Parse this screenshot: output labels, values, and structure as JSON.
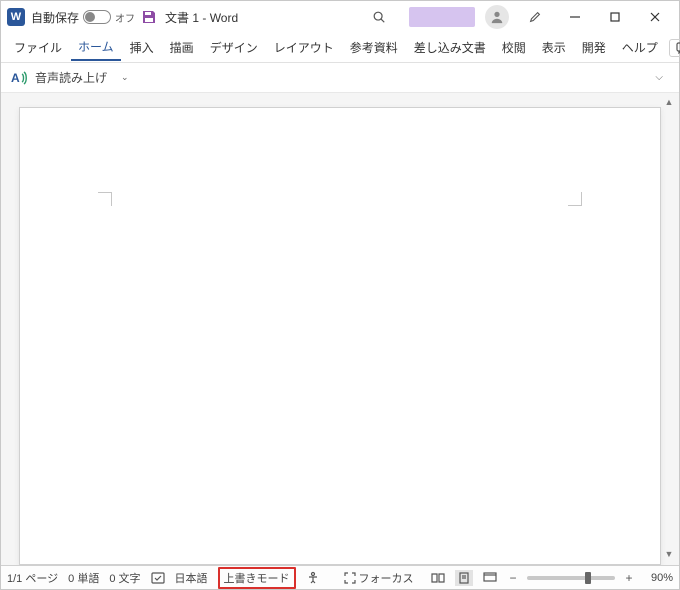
{
  "titlebar": {
    "autosave_label": "自動保存",
    "autosave_state": "オフ",
    "title": "文書 1  -  Word"
  },
  "ribbon": {
    "tabs": [
      "ファイル",
      "ホーム",
      "挿入",
      "描画",
      "デザイン",
      "レイアウト",
      "参考資料",
      "差し込み文書",
      "校閲",
      "表示",
      "開発",
      "ヘルプ"
    ]
  },
  "toolbar": {
    "readaloud": "音声読み上げ"
  },
  "status": {
    "page": "1/1 ページ",
    "words": "0 単語",
    "chars": "0 文字",
    "language": "日本語",
    "overwrite": "上書きモード",
    "focus": "フォーカス",
    "zoom": "90%"
  }
}
